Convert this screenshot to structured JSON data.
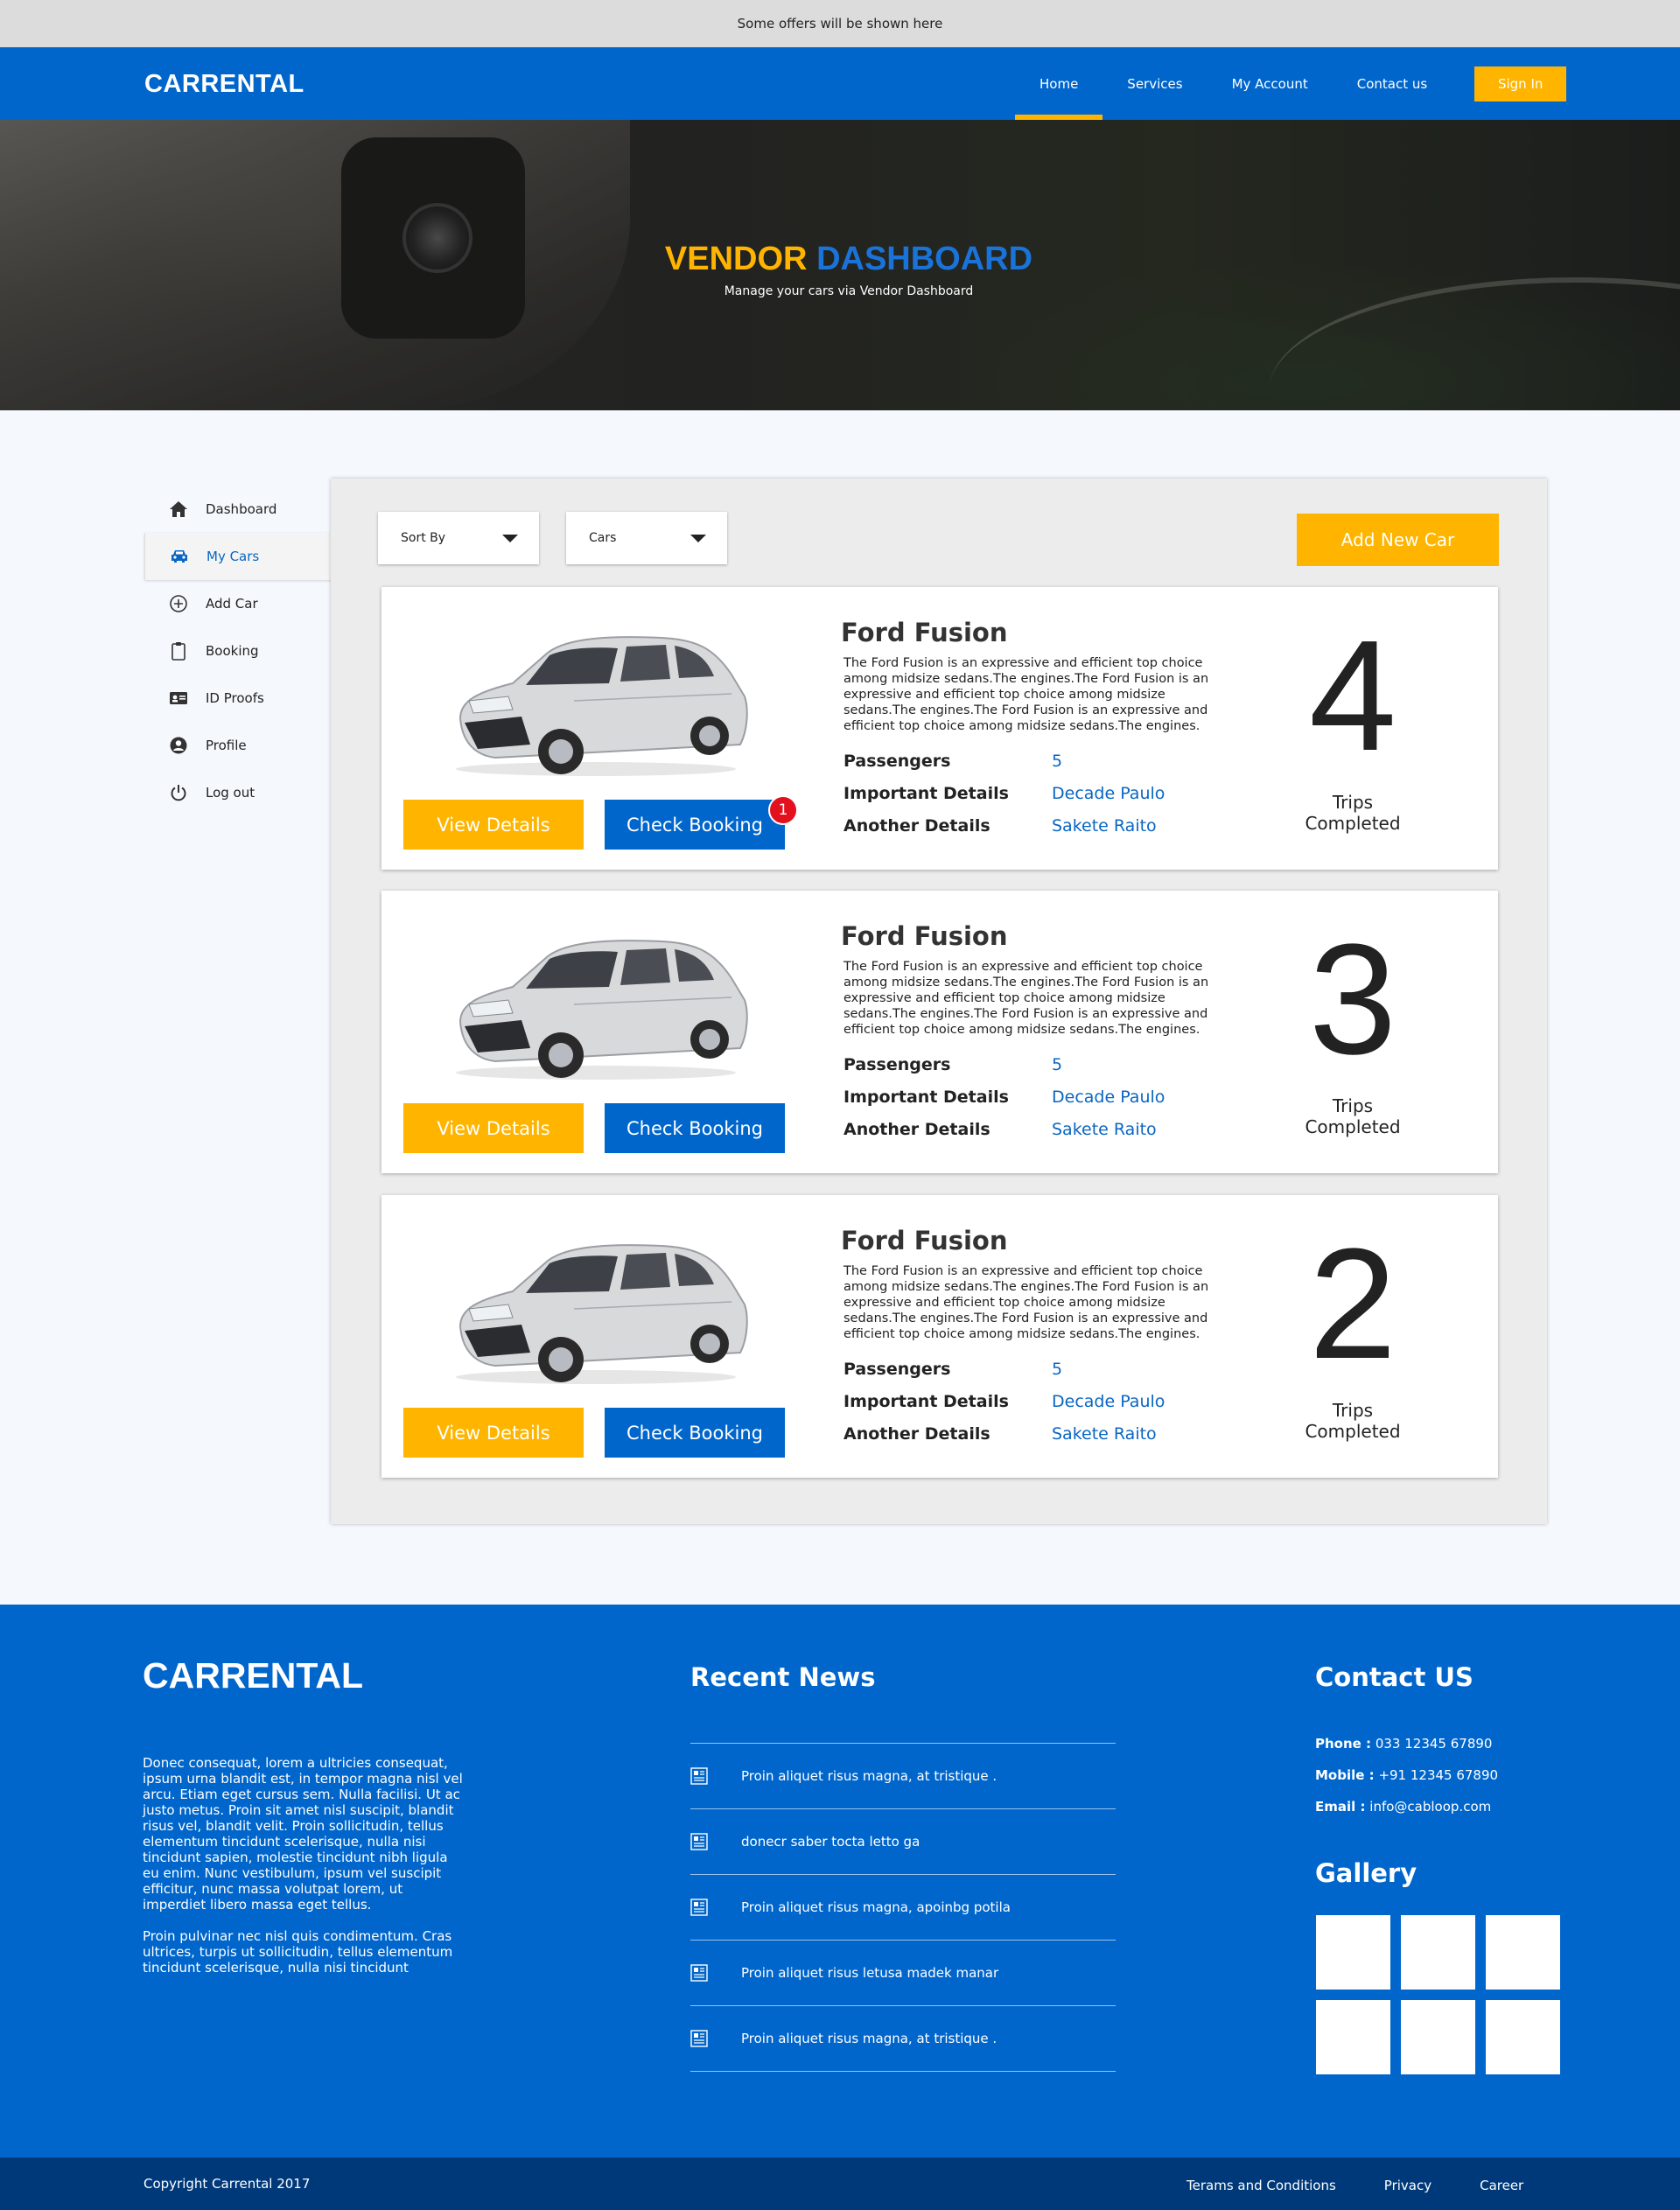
{
  "offer_bar": {
    "text": "Some offers will be shown here"
  },
  "header": {
    "logo": "CARRENTAL",
    "nav": [
      "Home",
      "Services",
      "My Account",
      "Contact us"
    ],
    "active_nav": "Home",
    "signin_label": "Sign In"
  },
  "hero": {
    "title_part1": "VENDOR",
    "title_part2": "DASHBOARD",
    "subtitle": "Manage your cars via Vendor Dashboard"
  },
  "sidebar": {
    "items": [
      {
        "label": "Dashboard",
        "icon": "home-icon"
      },
      {
        "label": "My Cars",
        "icon": "car-icon",
        "active": true
      },
      {
        "label": "Add Car",
        "icon": "plus-circle-icon"
      },
      {
        "label": "Booking",
        "icon": "clipboard-icon"
      },
      {
        "label": "ID Proofs",
        "icon": "id-card-icon"
      },
      {
        "label": "Profile",
        "icon": "user-circle-icon"
      },
      {
        "label": "Log out",
        "icon": "power-icon"
      }
    ]
  },
  "toolbar": {
    "sort_by": "Sort By",
    "filter": "Cars",
    "add_new_car": "Add New Car"
  },
  "cars": [
    {
      "name": "Ford Fusion",
      "description": "The Ford Fusion is an expressive and efficient top choice among midsize sedans.The engines.The Ford Fusion is an expressive and efficient top choice among midsize sedans.The engines.The Ford Fusion is an expressive and efficient top choice among midsize sedans.The engines.",
      "passengers_label": "Passengers",
      "passengers": "5",
      "important_label": "Important Details",
      "important": "Decade Paulo",
      "another_label": "Another Details",
      "another": "Sakete Raito",
      "trips": "4",
      "trips_label": "Trips\nCompleted",
      "view_label": "View Details",
      "book_label": "Check Booking",
      "badge": "1"
    },
    {
      "name": "Ford Fusion",
      "description": "The Ford Fusion is an expressive and efficient top choice among midsize sedans.The engines.The Ford Fusion is an expressive and efficient top choice among midsize sedans.The engines.The Ford Fusion is an expressive and efficient top choice among midsize sedans.The engines.",
      "passengers_label": "Passengers",
      "passengers": "5",
      "important_label": "Important Details",
      "important": "Decade Paulo",
      "another_label": "Another Details",
      "another": "Sakete Raito",
      "trips": "3",
      "trips_label": "Trips\nCompleted",
      "view_label": "View Details",
      "book_label": "Check Booking"
    },
    {
      "name": "Ford Fusion",
      "description": "The Ford Fusion is an expressive and efficient top choice among midsize sedans.The engines.The Ford Fusion is an expressive and efficient top choice among midsize sedans.The engines.The Ford Fusion is an expressive and efficient top choice among midsize sedans.The engines.",
      "passengers_label": "Passengers",
      "passengers": "5",
      "important_label": "Important Details",
      "important": "Decade Paulo",
      "another_label": "Another Details",
      "another": "Sakete Raito",
      "trips": "2",
      "trips_label": "Trips\nCompleted",
      "view_label": "View Details",
      "book_label": "Check Booking"
    }
  ],
  "footer": {
    "logo": "CARRENTAL",
    "about_p1": "Donec consequat, lorem a ultricies consequat, ipsum urna blandit est, in tempor magna nisl vel arcu. Etiam eget cursus sem. Nulla facilisi. Ut ac justo metus. Proin sit amet nisl suscipit, blandit risus vel, blandit velit. Proin sollicitudin, tellus elementum tincidunt scelerisque, nulla nisi tincidunt sapien, molestie tincidunt nibh ligula eu enim. Nunc vestibulum, ipsum vel suscipit efficitur, nunc massa volutpat lorem, ut imperdiet libero massa eget tellus.",
    "about_p2": "Proin pulvinar nec nisl quis condimentum. Cras ultrices, turpis ut sollicitudin, tellus elementum tincidunt scelerisque, nulla nisi tincidunt",
    "news_title": "Recent News",
    "news": [
      "Proin aliquet risus magna, at tristique .",
      "donecr saber tocta letto ga",
      "Proin aliquet risus magna, apoinbg potila",
      "Proin aliquet risus letusa madek manar",
      "Proin aliquet risus magna, at tristique ."
    ],
    "contact_title": "Contact US",
    "phone_label": "Phone :",
    "phone": "033 12345 67890",
    "mobile_label": "Mobile :",
    "mobile": "+91 12345 67890",
    "email_label": "Email :",
    "email": "info@cabloop.com",
    "gallery_title": "Gallery"
  },
  "bottom_bar": {
    "copyright": "Copyright Carrental 2017",
    "links": [
      "Terams and Conditions",
      "Privacy",
      "Career"
    ]
  },
  "colors": {
    "primary": "#0066cc",
    "accent": "#ffb400",
    "bottom_bar": "#00397a",
    "badge": "#e3101e"
  }
}
